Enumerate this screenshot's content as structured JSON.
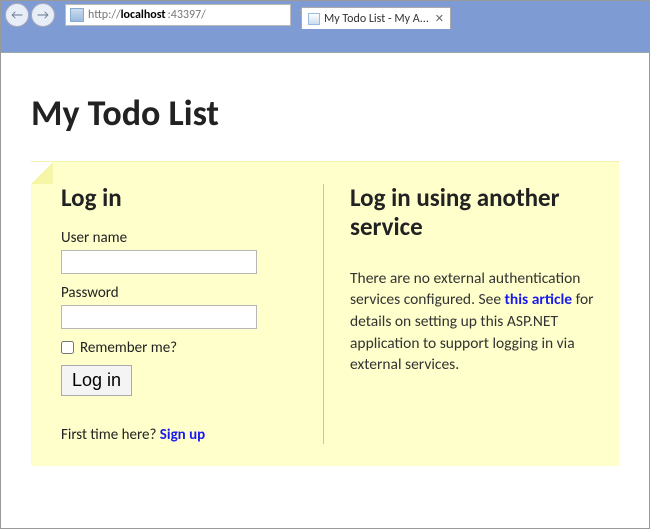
{
  "browser": {
    "url_prefix": "http://",
    "url_host": "localhost",
    "url_port": ":43397/",
    "tab_title": "My Todo List - My A..."
  },
  "page": {
    "title": "My Todo List"
  },
  "login": {
    "heading": "Log in",
    "username_label": "User name",
    "password_label": "Password",
    "remember_label": "Remember me?",
    "submit_label": "Log in"
  },
  "external": {
    "heading": "Log in using another service",
    "body_before": "There are no external authentication services configured. See ",
    "link_text": "this article",
    "body_after": " for details on setting up this ASP.NET application to support logging in via external services."
  },
  "signup": {
    "prompt": "First time here? ",
    "link": "Sign up"
  }
}
